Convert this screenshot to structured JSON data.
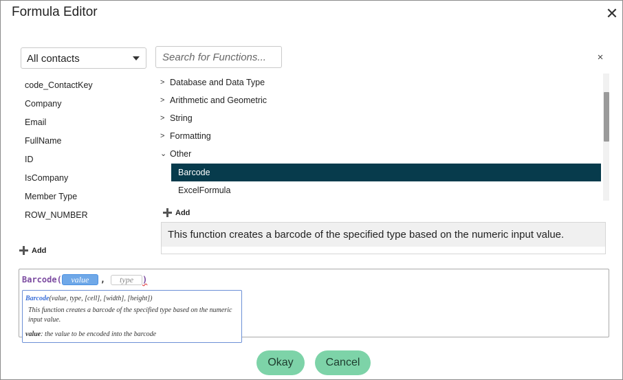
{
  "dialog": {
    "title": "Formula Editor",
    "close_glyph": "✕"
  },
  "contacts_select": {
    "selected": "All contacts"
  },
  "search": {
    "placeholder": "Search for Functions...",
    "clear_glyph": "×"
  },
  "fields": [
    "code_ContactKey",
    "Company",
    "Email",
    "FullName",
    "ID",
    "IsCompany",
    "Member Type",
    "ROW_NUMBER"
  ],
  "left_add_label": "Add",
  "function_tree": {
    "categories": [
      {
        "label": "Database and Data Type",
        "expanded": false,
        "chevron": ">"
      },
      {
        "label": "Arithmetic and Geometric",
        "expanded": false,
        "chevron": ">"
      },
      {
        "label": "String",
        "expanded": false,
        "chevron": ">"
      },
      {
        "label": "Formatting",
        "expanded": false,
        "chevron": ">"
      },
      {
        "label": "Other",
        "expanded": true,
        "chevron": "⌄"
      }
    ],
    "functions": [
      {
        "label": "Barcode",
        "selected": true
      },
      {
        "label": "ExcelFormula",
        "selected": false
      }
    ]
  },
  "right_add_label": "Add",
  "description": "This function creates a barcode of the specified type based on the numeric input value.",
  "editor": {
    "function_name": "Barcode",
    "open_paren": "(",
    "close_paren": ")",
    "comma": ",",
    "arg_value": "value",
    "arg_type": "type",
    "tooltip": {
      "sig_name": "Barcode",
      "sig_args": "(value, type, [cell], [width], [height])",
      "description": "This function creates a barcode of the specified type based on the numeric input value.",
      "param_name": "value",
      "param_desc": ": the value to be encoded into the barcode"
    }
  },
  "buttons": {
    "ok": "Okay",
    "cancel": "Cancel"
  },
  "colors": {
    "selected_row": "#073b4c",
    "button": "#7dd3a8",
    "function_name": "#7b4aa0",
    "token_value": "#6fa8e8"
  }
}
